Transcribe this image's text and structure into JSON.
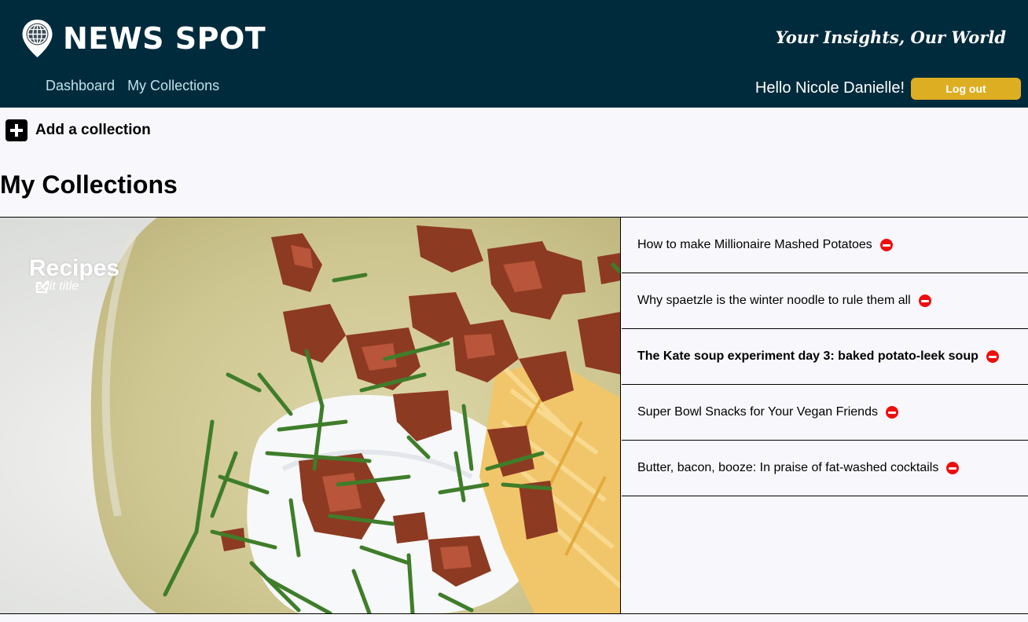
{
  "header": {
    "brand": "NEWS SPOT",
    "tagline": "Your Insights, Our World",
    "nav": [
      "Dashboard",
      "My Collections"
    ],
    "greeting": "Hello Nicole Danielle!",
    "logout_label": "Log out",
    "logo_icon": "globe-pin-icon"
  },
  "actions": {
    "add_collection_label": "Add a collection",
    "add_icon": "plus-square-icon"
  },
  "page": {
    "title": "My Collections"
  },
  "collection": {
    "title": "Recipes",
    "edit_label": "edit title",
    "edit_icon": "edit-icon",
    "articles": [
      "How to make Millionaire Mashed Potatoes",
      "Why spaetzle is the winter noodle to rule them all",
      "The Kate soup experiment day 3: baked potato-leek soup",
      "Super Bowl Snacks for Your Vegan Friends",
      "Butter, bacon, booze: In praise of fat-washed cocktails"
    ],
    "remove_icon": "remove-circle-icon"
  },
  "colors": {
    "header_bg": "#002b3d",
    "logout_bg": "#ddae22",
    "remove": "#ee0d0d",
    "page_bg": "#f8f8fc"
  }
}
